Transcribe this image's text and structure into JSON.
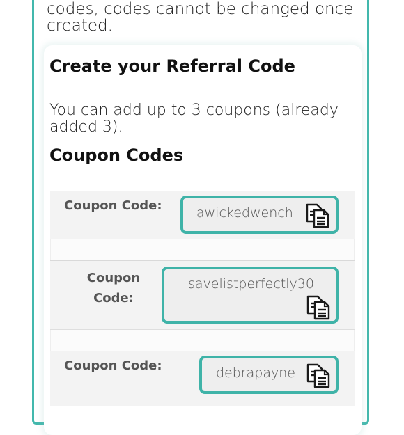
{
  "intro_text": "codes, codes cannot be changed once created.",
  "card": {
    "title": "Create your Referral Code",
    "description": "You can add up to 3 coupons (already added 3).",
    "subtitle": "Coupon Codes"
  },
  "coupons": [
    {
      "label": "Coupon Code:",
      "code": "awickedwench"
    },
    {
      "label": "Coupon Code:",
      "code": "savelistperfectly30"
    },
    {
      "label": "Coupon Code:",
      "code": "debrapayne"
    }
  ],
  "colors": {
    "accent": "#3fb3a8",
    "row_background": "#f3f3f3",
    "label_text": "#555555"
  },
  "icons": {
    "copy": "copy-clipboard-icon"
  }
}
